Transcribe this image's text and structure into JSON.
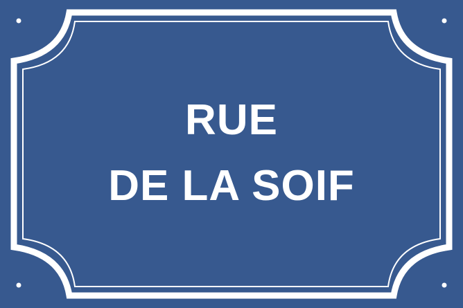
{
  "sign": {
    "line_1": "RUE",
    "line_2": "DE LA SOIF",
    "background_color": "#37598f",
    "border_color": "#ffffff",
    "text_color": "#ffffff"
  }
}
